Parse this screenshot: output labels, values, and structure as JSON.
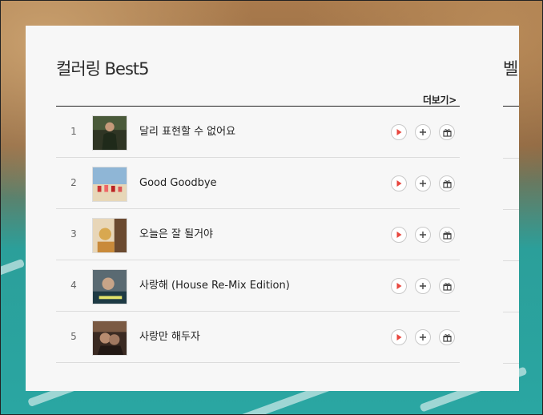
{
  "chart": {
    "title": "컬러링 Best5",
    "more_link": "더보기>",
    "songs": [
      {
        "rank": "1",
        "title": "달리 표현할 수 없어요",
        "thumb": "album-cover-1"
      },
      {
        "rank": "2",
        "title": "Good Goodbye",
        "thumb": "album-cover-2"
      },
      {
        "rank": "3",
        "title": "오늘은 잘 될거야",
        "thumb": "album-cover-3"
      },
      {
        "rank": "4",
        "title": "사랑해 (House Re-Mix Edition)",
        "thumb": "album-cover-4"
      },
      {
        "rank": "5",
        "title": "사랑만 해두자",
        "thumb": "album-cover-5"
      }
    ],
    "actions": {
      "play_icon": "play-icon",
      "add_icon": "plus-icon",
      "gift_icon": "gift-icon"
    }
  },
  "next_section": {
    "title_partial": "벨"
  },
  "colors": {
    "play_accent": "#e8473f",
    "teal_background": "#2aa6a2",
    "panel_bg": "#f7f7f7"
  }
}
